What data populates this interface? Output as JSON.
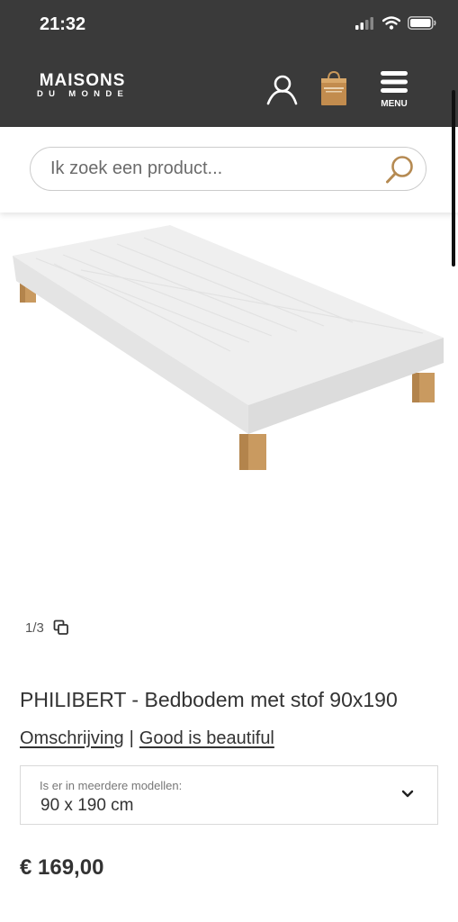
{
  "status_bar": {
    "time": "21:32"
  },
  "header": {
    "logo_main": "MAISONS",
    "logo_sub": "DU MONDE",
    "menu_label": "MENU",
    "background": "#3a3a3a"
  },
  "search": {
    "placeholder": "Ik zoek een product..."
  },
  "gallery": {
    "counter": "1/3"
  },
  "product": {
    "title": "PHILIBERT - Bedbodem met stof 90x190",
    "link_description": "Omschrijving",
    "link_separator": "|",
    "link_good": "Good is beautiful",
    "variant_label": "Is er in meerdere modellen:",
    "variant_value": "90 x 190 cm",
    "price": "€ 169,00"
  },
  "icons": [
    "signal-icon",
    "wifi-icon",
    "battery-icon",
    "account-icon",
    "shopping-bag-icon",
    "menu-icon",
    "search-icon",
    "gallery-icon",
    "chevron-down-icon"
  ]
}
